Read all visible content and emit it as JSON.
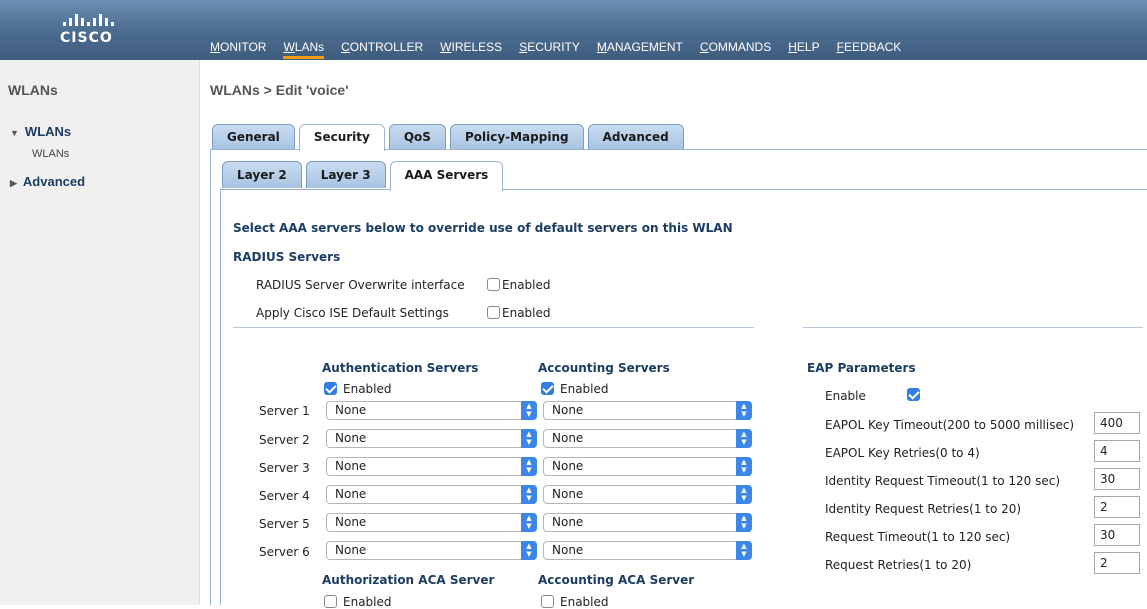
{
  "brand": "CISCO",
  "nav": [
    "MONITOR",
    "WLANs",
    "CONTROLLER",
    "WIRELESS",
    "SECURITY",
    "MANAGEMENT",
    "COMMANDS",
    "HELP",
    "FEEDBACK"
  ],
  "sidebar": {
    "title": "WLANs",
    "group1": "WLANs",
    "group1_sub": "WLANs",
    "group2": "Advanced"
  },
  "page_title": "WLANs > Edit  'voice'",
  "tabs": [
    "General",
    "Security",
    "QoS",
    "Policy-Mapping",
    "Advanced"
  ],
  "subtabs": [
    "Layer 2",
    "Layer 3",
    "AAA Servers"
  ],
  "aaa": {
    "intro": "Select AAA servers below to override use of default servers on this WLAN",
    "radius_heading": "RADIUS Servers",
    "overwrite_label": "RADIUS Server Overwrite interface",
    "overwrite_value": "Enabled",
    "ise_label": "Apply Cisco ISE Default Settings",
    "ise_value": "Enabled",
    "auth_heading": "Authentication Servers",
    "acct_heading": "Accounting Servers",
    "auth_enabled": "Enabled",
    "acct_enabled": "Enabled",
    "servers": [
      {
        "label": "Server 1",
        "auth": "None",
        "acct": "None"
      },
      {
        "label": "Server 2",
        "auth": "None",
        "acct": "None"
      },
      {
        "label": "Server 3",
        "auth": "None",
        "acct": "None"
      },
      {
        "label": "Server 4",
        "auth": "None",
        "acct": "None"
      },
      {
        "label": "Server 5",
        "auth": "None",
        "acct": "None"
      },
      {
        "label": "Server 6",
        "auth": "None",
        "acct": "None"
      }
    ],
    "authz_aca_heading": "Authorization ACA Server",
    "acct_aca_heading": "Accounting ACA Server",
    "authz_aca_enabled": "Enabled",
    "acct_aca_enabled": "Enabled"
  },
  "eap": {
    "heading": "EAP Parameters",
    "enable_label": "Enable",
    "params": [
      {
        "label": "EAPOL Key Timeout(200 to 5000 millisec)",
        "value": "400"
      },
      {
        "label": "EAPOL Key Retries(0 to 4)",
        "value": "4"
      },
      {
        "label": "Identity Request Timeout(1 to 120 sec)",
        "value": "30"
      },
      {
        "label": "Identity Request Retries(1 to 20)",
        "value": "2"
      },
      {
        "label": "Request Timeout(1 to 120 sec)",
        "value": "30"
      },
      {
        "label": "Request Retries(1 to 20)",
        "value": "2"
      }
    ]
  }
}
